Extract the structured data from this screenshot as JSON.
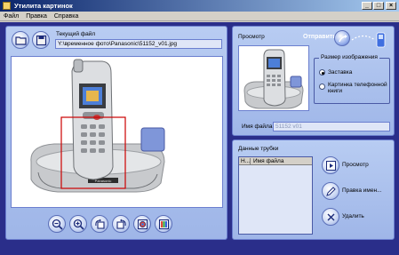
{
  "window": {
    "title": "Утилита картинок"
  },
  "menu": [
    "Файл",
    "Правка",
    "Справка"
  ],
  "left_panel": {
    "current_file_label": "Текущий файл",
    "current_file_path": "Y:\\временное фото\\Panasonic\\51152_v01.jpg"
  },
  "preview_panel": {
    "title": "Просмотр",
    "send_label": "Отправить",
    "image_size_group": "Размер изображения",
    "options": [
      "Заставка",
      "Картинка телефонной книги"
    ],
    "selected_option": "Заставка",
    "filename_label": "Имя файла",
    "filename_value": "51152 v01"
  },
  "handset_panel": {
    "title": "Данные трубки",
    "columns": [
      "Н...",
      "Имя файла"
    ],
    "actions": [
      "Просмотр",
      "Правка имен...",
      "Удалить"
    ]
  },
  "toolbar_icons": [
    "zoom-out-icon",
    "zoom-in-icon",
    "rotate-left-icon",
    "rotate-right-icon",
    "color-adjust-icon",
    "color-bars-icon"
  ],
  "colors": {
    "title_start": "#0a246a",
    "title_end": "#a6caf0",
    "background": "#2a2e8a",
    "panel": "#b8ccf2",
    "crop_frame": "#cc0000"
  }
}
